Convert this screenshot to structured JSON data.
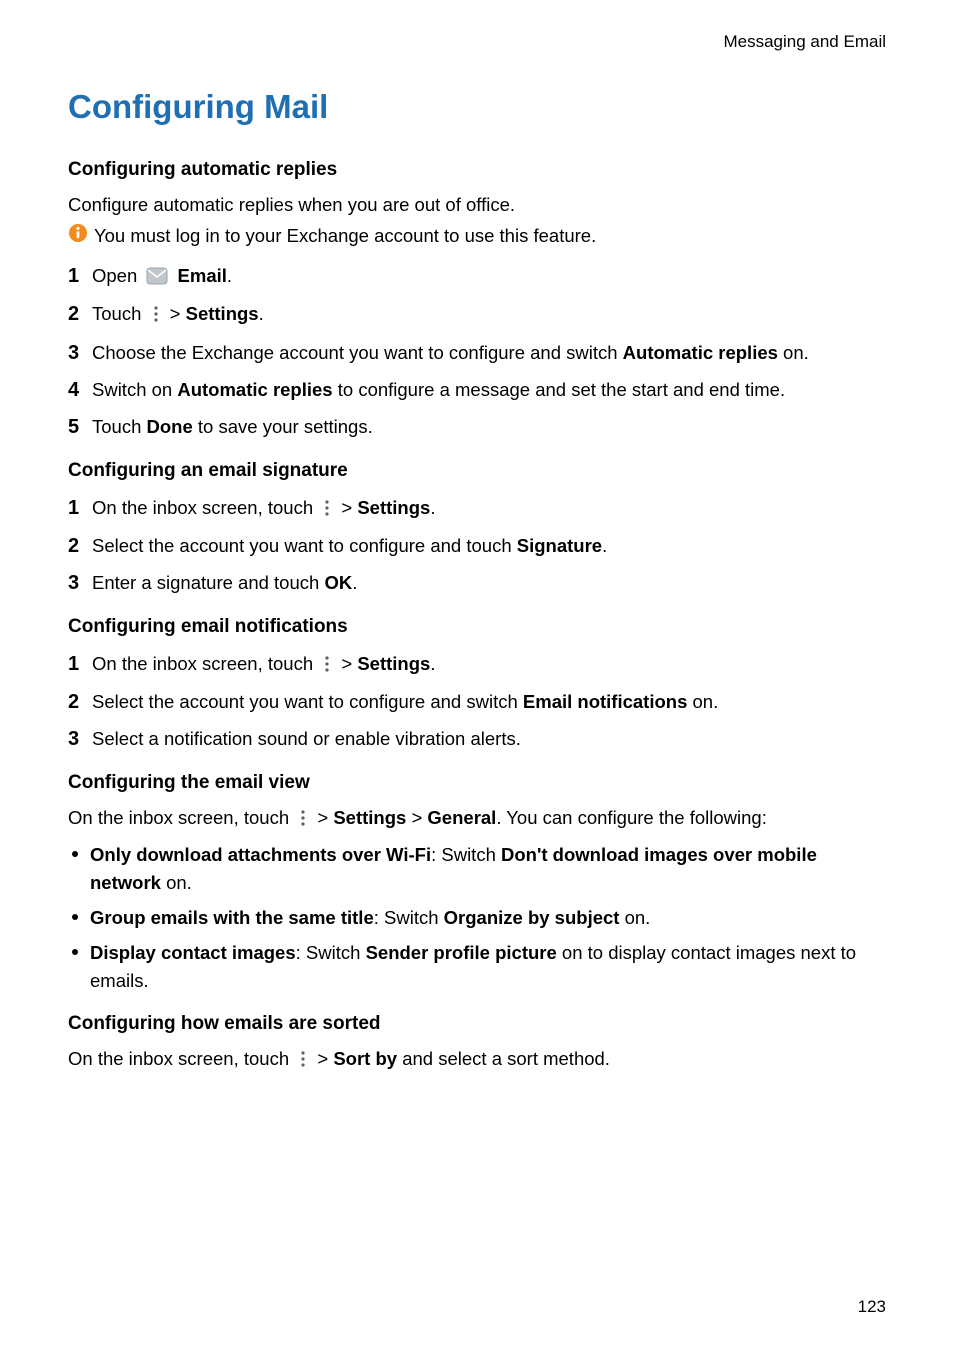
{
  "header": {
    "section_label": "Messaging and Email"
  },
  "title": "Configuring Mail",
  "sec1": {
    "heading": "Configuring automatic replies",
    "intro": "Configure automatic replies when you are out of office.",
    "note": "You must log in to your Exchange account to use this feature.",
    "step1_a": "Open ",
    "step1_b": "Email",
    "step1_c": ".",
    "step2_a": "Touch ",
    "step2_b": "Settings",
    "step2_gt": " > ",
    "step2_c": ".",
    "step3_a": "Choose the Exchange account you want to configure and switch ",
    "step3_b": "Automatic replies",
    "step3_c": " on.",
    "step4_a": "Switch on ",
    "step4_b": "Automatic replies",
    "step4_c": " to configure a message and set the start and end time.",
    "step5_a": "Touch ",
    "step5_b": "Done",
    "step5_c": " to save your settings."
  },
  "sec2": {
    "heading": "Configuring an email signature",
    "step1_a": "On the inbox screen, touch ",
    "step1_gt": " > ",
    "step1_b": "Settings",
    "step1_c": ".",
    "step2_a": "Select the account you want to configure and touch ",
    "step2_b": "Signature",
    "step2_c": ".",
    "step3_a": "Enter a signature and touch ",
    "step3_b": "OK",
    "step3_c": "."
  },
  "sec3": {
    "heading": "Configuring email notifications",
    "step1_a": "On the inbox screen, touch ",
    "step1_gt": " > ",
    "step1_b": "Settings",
    "step1_c": ".",
    "step2_a": "Select the account you want to configure and switch ",
    "step2_b": "Email notifications",
    "step2_c": " on.",
    "step3": "Select a notification sound or enable vibration alerts."
  },
  "sec4": {
    "heading": "Configuring the email view",
    "intro_a": "On the inbox screen, touch ",
    "intro_gt": " > ",
    "intro_b": "Settings",
    "intro_gt2": " > ",
    "intro_c": "General",
    "intro_d": ". You can configure the following:",
    "b1_a": "Only download attachments over Wi-Fi",
    "b1_b": ": Switch ",
    "b1_c": "Don't download images over mobile network",
    "b1_d": " on.",
    "b2_a": "Group emails with the same title",
    "b2_b": ": Switch ",
    "b2_c": "Organize by subject",
    "b2_d": " on.",
    "b3_a": "Display contact images",
    "b3_b": ": Switch ",
    "b3_c": "Sender profile picture",
    "b3_d": " on to display contact images next to emails."
  },
  "sec5": {
    "heading": "Configuring how emails are sorted",
    "intro_a": "On the inbox screen, touch ",
    "intro_gt": " > ",
    "intro_b": "Sort by",
    "intro_c": " and select a sort method."
  },
  "nums": {
    "n1": "1",
    "n2": "2",
    "n3": "3",
    "n4": "4",
    "n5": "5"
  },
  "page_number": "123"
}
